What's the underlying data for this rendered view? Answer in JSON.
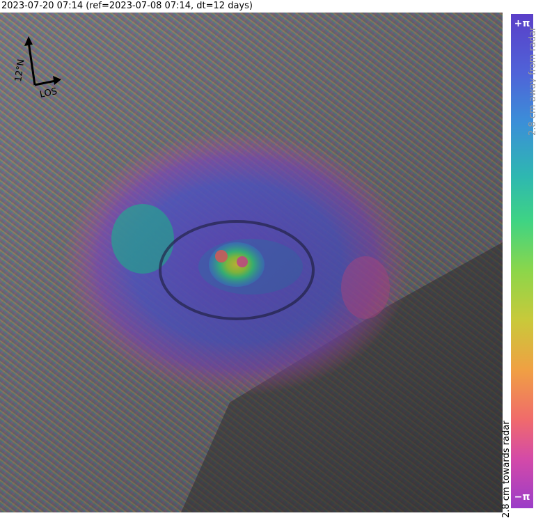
{
  "title": "2023-07-20 07:14 (ref=2023-07-08 07:14, dt=12 days)",
  "compass": {
    "north_label": "12°N",
    "los_label": "LOS"
  },
  "colorbar": {
    "top_label": "+π",
    "bottom_label": "−π",
    "away_label": "2.8 cm away from radar",
    "towards_label": "2.8 cm towards radar",
    "colors": [
      "#5a3fc8",
      "#3b8fd8",
      "#2eb8b0",
      "#3fd483",
      "#8cd64a",
      "#c9c93a",
      "#f0a043",
      "#f06b6b",
      "#d44aa8",
      "#9b3cc8"
    ]
  }
}
